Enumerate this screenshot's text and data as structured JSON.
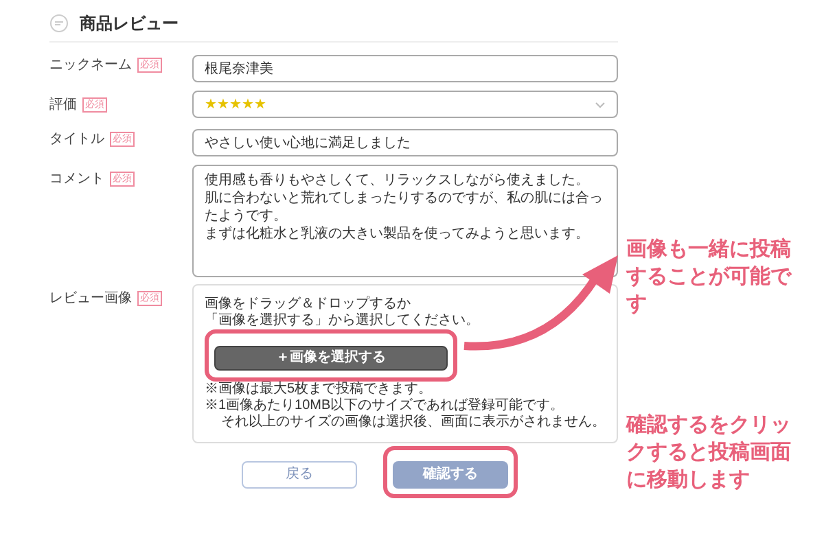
{
  "section": {
    "title": "商品レビュー"
  },
  "fields": [
    {
      "label": "ニックネーム",
      "badge": "必須",
      "kind": "text",
      "value": "根尾奈津美"
    },
    {
      "label": "評価",
      "badge": "必須",
      "kind": "select",
      "value": "★★★★★"
    },
    {
      "label": "タイトル",
      "badge": "必須",
      "kind": "text",
      "value": "やさしい使い心地に満足しました"
    },
    {
      "label": "コメント",
      "badge": "必須",
      "kind": "textarea",
      "lines": [
        "使用感も香りもやさしくて、リラックスしながら使えました。",
        "肌に合わないと荒れてしまったりするのですが、私の肌には合ったようです。",
        "まずは化粧水と乳液の大きい製品を使ってみようと思います。"
      ]
    },
    {
      "label": "レビュー画像",
      "badge": "必須",
      "kind": "upload",
      "intro": [
        "画像をドラッグ＆ドロップするか",
        "「画像を選択する」から選択してください。"
      ],
      "button": {
        "label": "＋画像を選択する",
        "highlighted": true
      },
      "notes": [
        "※画像は最大5枚まで投稿できます。",
        "※1画像あたり10MB以下のサイズであれば登録可能です。",
        "それ以上のサイズの画像は選択後、画面に表示がされません。"
      ]
    }
  ],
  "buttons": [
    {
      "label": "戻る",
      "kind": "secondary",
      "highlighted": false
    },
    {
      "label": "確認する",
      "kind": "primary",
      "highlighted": true
    }
  ],
  "annotations": [
    "画像も一緒に投稿することが可能です",
    "確認するをクリックすると投稿画面に移動します"
  ]
}
